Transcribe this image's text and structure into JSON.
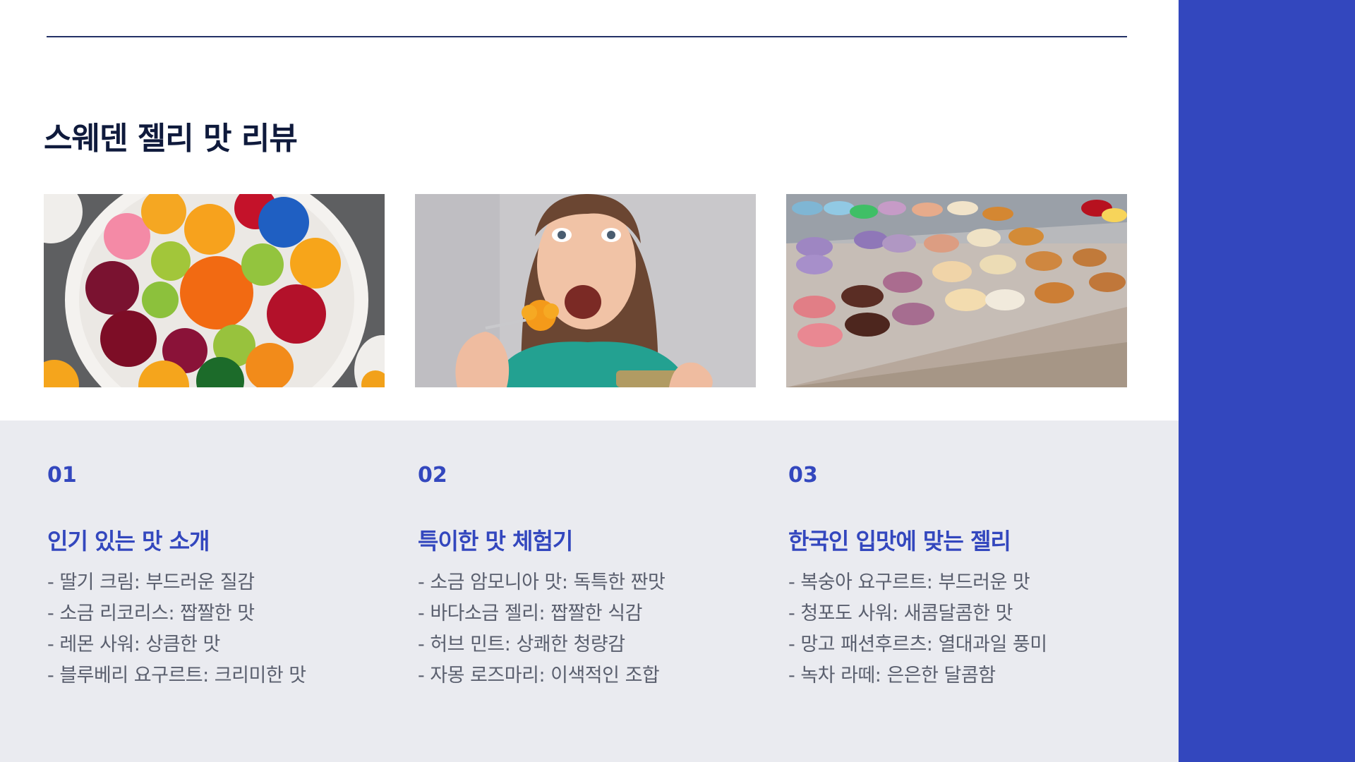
{
  "colors": {
    "accent": "#3347be",
    "band": "#3347be",
    "lower_bg": "#eaebf0",
    "title": "#0f1a3c"
  },
  "title": "스웨덴 젤리 맛 리뷰",
  "images": [
    {
      "icon": "colorful-jelly-candies-plate-image"
    },
    {
      "icon": "surprised-woman-tasting-jelly-image"
    },
    {
      "icon": "macarons-display-tray-image"
    }
  ],
  "columns": [
    {
      "number": "01",
      "heading": "인기 있는 맛 소개",
      "items": [
        "- 딸기 크림: 부드러운 질감",
        "- 소금 리코리스: 짭짤한 맛",
        "- 레몬 사워: 상큼한 맛",
        "- 블루베리 요구르트: 크리미한 맛"
      ]
    },
    {
      "number": "02",
      "heading": "특이한 맛 체험기",
      "items": [
        "- 소금 암모니아 맛: 독특한 짠맛",
        "- 바다소금 젤리: 짭짤한 식감",
        "- 허브 민트: 상쾌한 청량감",
        "- 자몽 로즈마리: 이색적인 조합"
      ]
    },
    {
      "number": "03",
      "heading": "한국인 입맛에 맞는 젤리",
      "items": [
        "- 복숭아 요구르트: 부드러운 맛",
        "- 청포도 사워: 새콤달콤한 맛",
        "- 망고 패션후르츠: 열대과일 풍미",
        "- 녹차 라떼: 은은한 달콤함"
      ]
    }
  ]
}
